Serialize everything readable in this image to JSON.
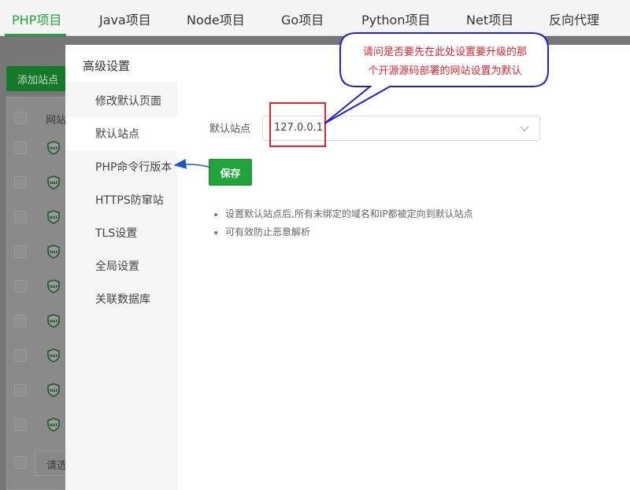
{
  "top_nav": {
    "tabs": [
      {
        "label": "PHP项目",
        "active": true
      },
      {
        "label": "Java项目"
      },
      {
        "label": "Node项目"
      },
      {
        "label": "Go项目"
      },
      {
        "label": "Python项目"
      },
      {
        "label": "Net项目"
      },
      {
        "label": "反向代理"
      }
    ]
  },
  "background": {
    "add_site_button": "添加站点",
    "table_header": "网站",
    "batch_select_placeholder": "请选",
    "waf_badge": "WAF",
    "row_count": 9
  },
  "dialog": {
    "title": "高级设置",
    "menu": [
      {
        "label": "修改默认页面"
      },
      {
        "label": "默认站点",
        "active": true
      },
      {
        "label": "PHP命令行版本"
      },
      {
        "label": "HTTPS防窜站"
      },
      {
        "label": "TLS设置"
      },
      {
        "label": "全局设置"
      },
      {
        "label": "关联数据库"
      }
    ],
    "default_site_label": "默认站点",
    "default_site_value": "127.0.0.1",
    "save_label": "保存",
    "hints": [
      "设置默认站点后,所有未绑定的域名和IP都被定向到默认站点",
      "可有效防止恶意解析"
    ]
  },
  "annotation": {
    "bubble_line1": "请问是否要先在此处设置要升级的那",
    "bubble_line2": "个开源源码部署的网站设置为默认"
  },
  "colors": {
    "accent": "#20a53a",
    "annotation_red": "#e8232f",
    "annotation_blue": "#1f1fd6"
  }
}
